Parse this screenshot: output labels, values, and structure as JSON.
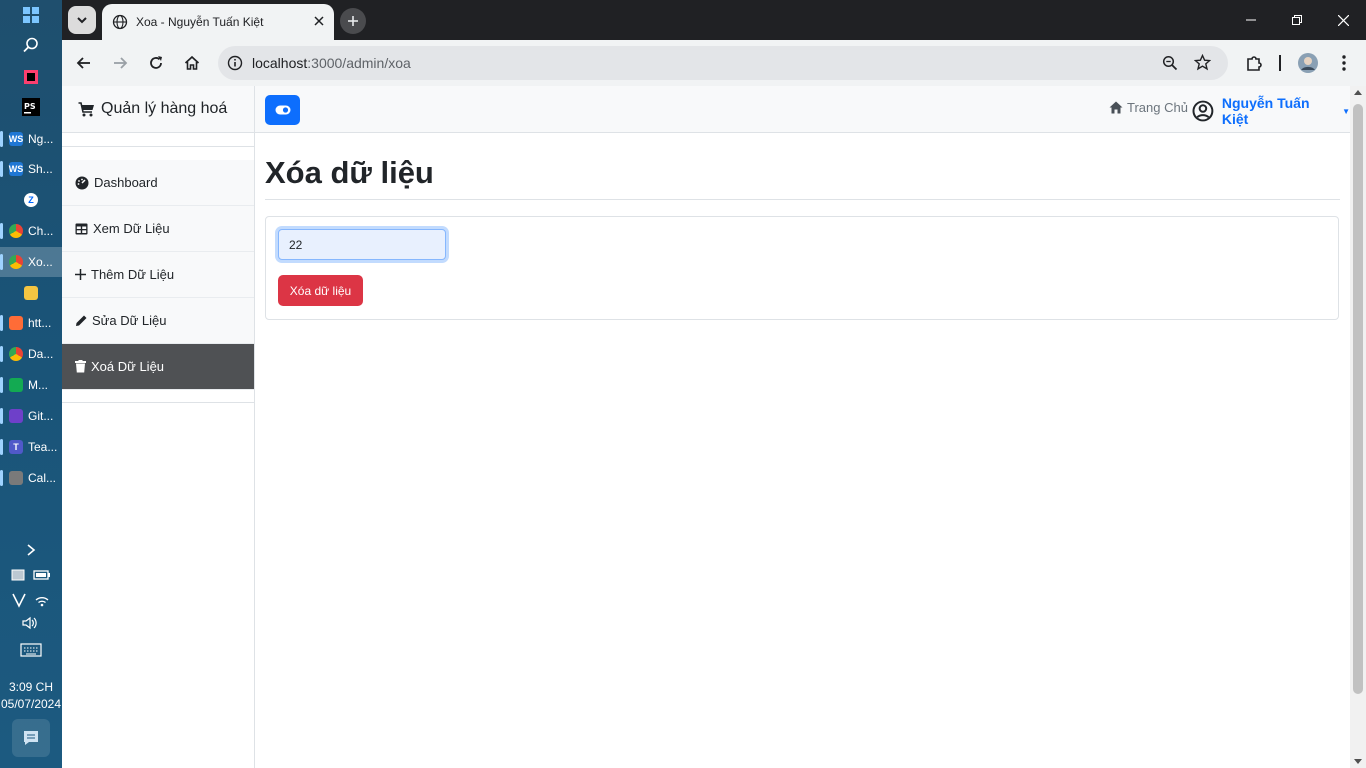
{
  "taskbar": {
    "apps": [
      {
        "label": "Ng...",
        "icon": "webstorm-icon",
        "color": "#1f77d4"
      },
      {
        "label": "Sh...",
        "icon": "webstorm-icon",
        "color": "#1f77d4"
      },
      {
        "label": "",
        "icon": "zalo-icon",
        "color": "#0068ff"
      },
      {
        "label": "Ch...",
        "icon": "chrome-icon",
        "color": "#34a853"
      },
      {
        "label": "Xo...",
        "icon": "chrome-icon",
        "color": "#34a853"
      },
      {
        "label": "",
        "icon": "file-explorer-icon",
        "color": "#f4c542"
      },
      {
        "label": "htt...",
        "icon": "postman-icon",
        "color": "#ff6c37"
      },
      {
        "label": "Da...",
        "icon": "chrome-icon",
        "color": "#34a853"
      },
      {
        "label": "M...",
        "icon": "mongodb-compass-icon",
        "color": "#13aa52"
      },
      {
        "label": "Git...",
        "icon": "github-desktop-icon",
        "color": "#6e40c9"
      },
      {
        "label": "Tea...",
        "icon": "teams-icon",
        "color": "#5059c9"
      },
      {
        "label": "Cal...",
        "icon": "calculator-icon",
        "color": "#7a7a7a"
      }
    ],
    "time": "3:09 CH",
    "date": "05/07/2024"
  },
  "browser": {
    "tab_title": "Xoa - Nguyễn Tuấn Kiệt",
    "url_host": "localhost",
    "url_path": ":3000/admin/xoa"
  },
  "sidebar": {
    "brand": "Quản lý hàng hoá",
    "items": [
      {
        "label": "Dashboard",
        "icon": "dashboard-icon"
      },
      {
        "label": "Xem Dữ Liệu",
        "icon": "table-icon"
      },
      {
        "label": "Thêm Dữ Liệu",
        "icon": "plus-icon"
      },
      {
        "label": "Sửa Dữ Liệu",
        "icon": "pencil-icon"
      },
      {
        "label": "Xoá Dữ Liệu",
        "icon": "trash-icon"
      }
    ]
  },
  "topnav": {
    "home_label": "Trang Chủ",
    "user_name": "Nguyễn Tuấn Kiệt"
  },
  "main": {
    "title": "Xóa dữ liệu",
    "id_value": "22",
    "delete_label": "Xóa dữ liệu"
  },
  "colors": {
    "primary": "#0d6efd",
    "danger": "#dc3545",
    "active_item": "#4f5154"
  }
}
